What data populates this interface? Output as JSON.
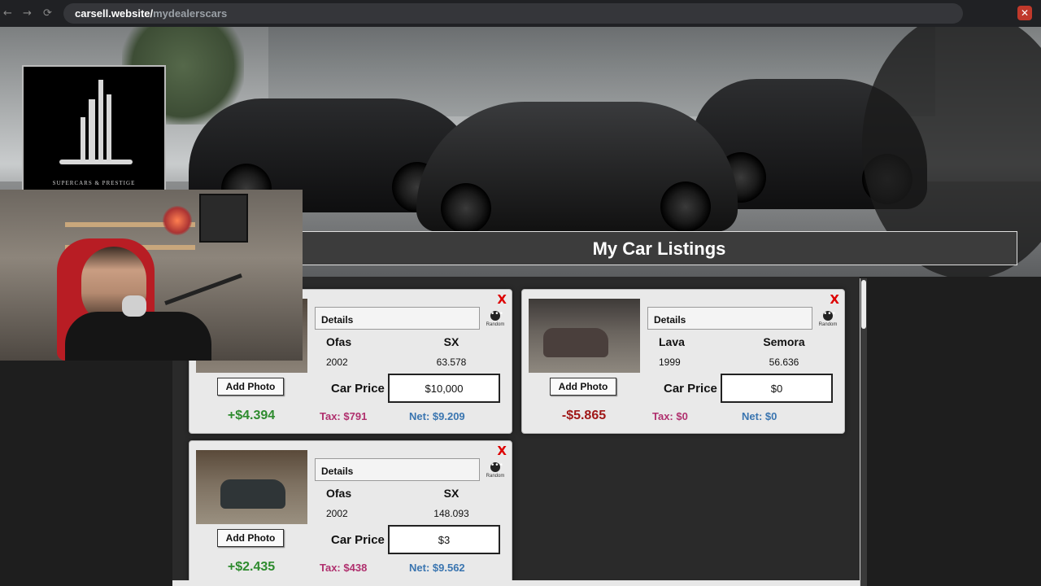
{
  "browser": {
    "url_host": "carsell.website/",
    "url_path": "mydealerscars",
    "back_glyph": "←",
    "forward_glyph": "→",
    "reload_glyph": "⟳",
    "close_glyph": "✕"
  },
  "header": {
    "title": "My Car Listings",
    "logo_text": "SUPERCARS & PRESTIGE"
  },
  "listing_labels": {
    "details": "Details",
    "random": "Random",
    "add_photo": "Add Photo",
    "car_price": "Car Price",
    "remove": "X"
  },
  "listings": [
    {
      "make": "Ofas",
      "model": "SX",
      "year": "2002",
      "mileage": "63.578",
      "price": "$10,000",
      "profit": "+$4.394",
      "tax": "Tax: $791",
      "net": "Net: $9.209"
    },
    {
      "make": "Lava",
      "model": "Semora",
      "year": "1999",
      "mileage": "56.636",
      "price": "$0",
      "profit": "-$5.865",
      "tax": "Tax: $0",
      "net": "Net: $0"
    },
    {
      "make": "Ofas",
      "model": "SX",
      "year": "2002",
      "mileage": "148.093",
      "price": "$3",
      "profit": "+$2.435",
      "tax": "Tax: $438",
      "net": "Net: $9.562"
    }
  ],
  "colors": {
    "profit_positive": "#2e8b2e",
    "profit_negative": "#a01818",
    "tax": "#b0306e",
    "net": "#3a75b0"
  }
}
